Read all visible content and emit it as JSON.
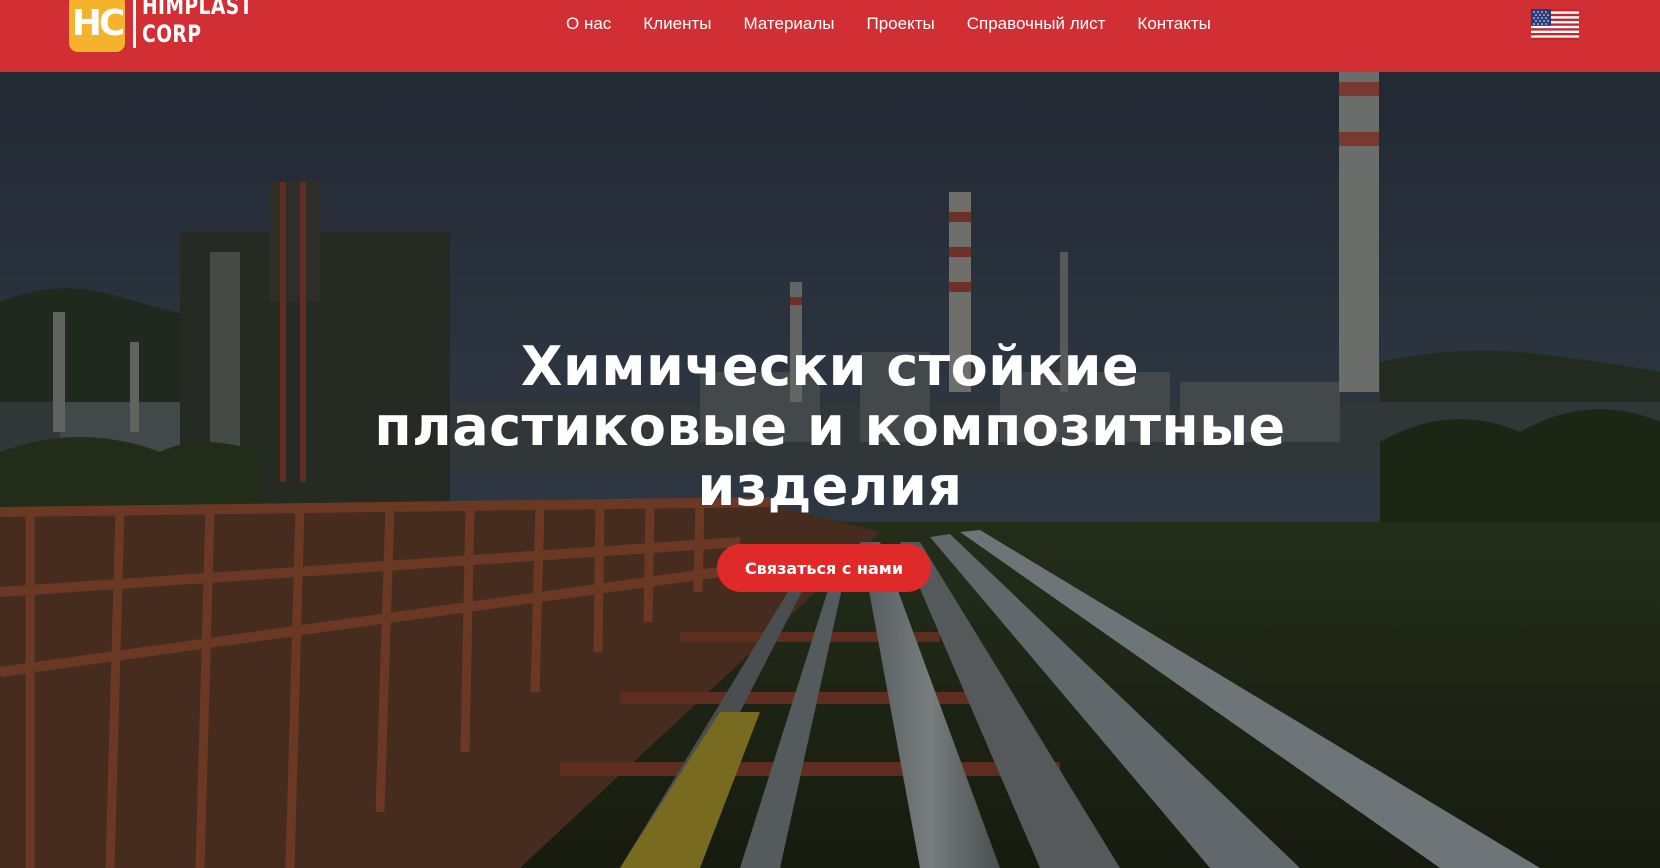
{
  "brand": {
    "badge": "HC",
    "line1": "HIMPLAST",
    "line2": "CORP",
    "color_header": "#d12f34",
    "color_badge": "#f4b32b",
    "color_cta": "#e02a2a"
  },
  "nav": {
    "items": [
      {
        "label": "О нас"
      },
      {
        "label": "Клиенты"
      },
      {
        "label": "Материалы"
      },
      {
        "label": "Проекты"
      },
      {
        "label": "Справочный лист"
      },
      {
        "label": "Контакты"
      }
    ]
  },
  "language": {
    "icon": "us-flag-icon"
  },
  "hero": {
    "title_lines": [
      "Химически стойкие",
      "пластиковые и композитные",
      "изделия"
    ],
    "cta_label": "Связаться с нами"
  }
}
